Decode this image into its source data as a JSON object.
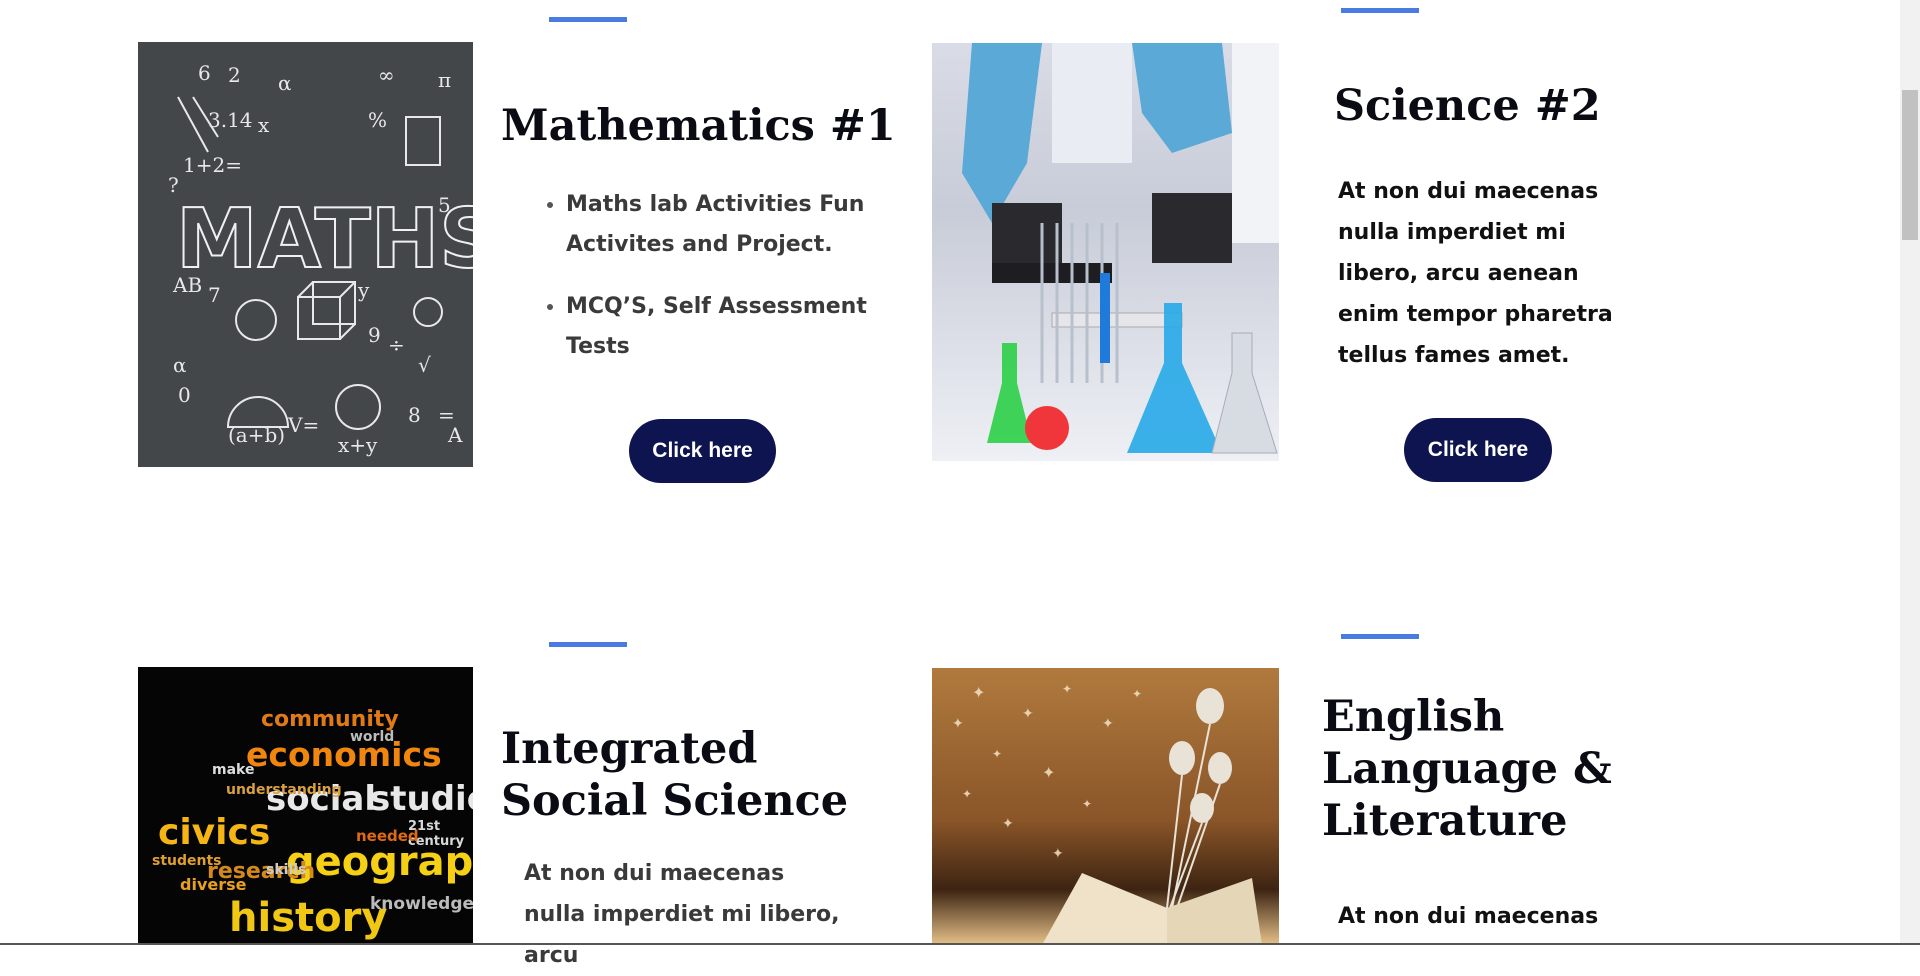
{
  "cards": [
    {
      "title": "Mathematics #1",
      "bullets": [
        "Maths lab Activities Fun Activites and Project.",
        "MCQ’S, Self Assessment Tests"
      ],
      "button_label": "Click here",
      "image_icon": "maths-chalkboard-image"
    },
    {
      "title": "Science #2",
      "paragraph": "At non dui maecenas nulla imperdiet mi libero, arcu aenean enim tempor pharetra tellus fames amet.",
      "button_label": "Click here",
      "image_icon": "science-lab-glassware-image"
    },
    {
      "title": "Integrated Social Science",
      "paragraph": "At non dui maecenas nulla imperdiet mi libero, arcu",
      "image_icon": "social-studies-word-cloud-image",
      "word_cloud": [
        "community",
        "economics",
        "social",
        "studies",
        "civics",
        "geography",
        "history",
        "research",
        "knowledge",
        "21st century",
        "skills",
        "world",
        "make",
        "understanding",
        "diverse",
        "students",
        "needed"
      ]
    },
    {
      "title": "English Language & Literature",
      "paragraph": "At non dui maecenas",
      "image_icon": "open-book-butterflies-image"
    }
  ],
  "colors": {
    "accent": "#4a7be0",
    "button": "#0e1450",
    "text": "#0b0b14"
  }
}
